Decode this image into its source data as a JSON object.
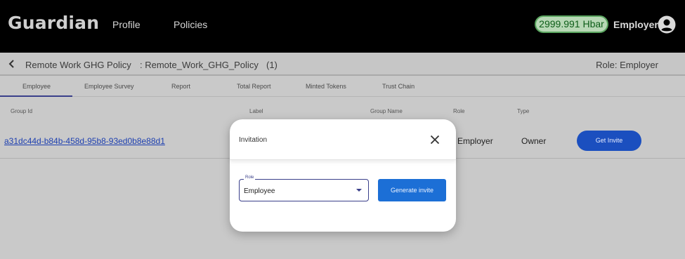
{
  "header": {
    "logo": "Guardian",
    "nav": [
      "Profile",
      "Policies"
    ],
    "balance": "2999.991 Hbar",
    "user": "Employer",
    "avatar_icon": "account-circle-icon"
  },
  "breadcrumb": {
    "policy_name": "Remote Work GHG Policy",
    "policy_id": ": Remote_Work_GHG_Policy",
    "count": "(1)",
    "role": "Role: Employer"
  },
  "tabs": [
    "Employee",
    "Employee Survey",
    "Report",
    "Total Report",
    "Minted Tokens",
    "Trust Chain"
  ],
  "table": {
    "columns": [
      "Group Id",
      "Label",
      "Group Name",
      "Role",
      "Type"
    ],
    "rows": [
      {
        "group_id": "a31dc44d-b84b-458d-95b8-93ed0b8e88d1",
        "role": "Employer",
        "type": "Owner",
        "action": "Get Invite"
      }
    ]
  },
  "modal": {
    "title": "Invitation",
    "select_label": "Role",
    "select_value": "Employee",
    "generate_label": "Generate invite"
  },
  "colors": {
    "header_bg": "#000000",
    "accent": "#1c6fd6",
    "balance_border": "#5aa55f"
  }
}
